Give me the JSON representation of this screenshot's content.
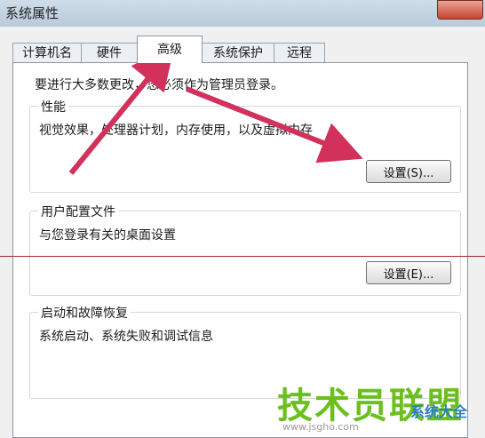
{
  "window": {
    "title": "系统属性"
  },
  "tabs": [
    {
      "label": "计算机名"
    },
    {
      "label": "硬件"
    },
    {
      "label": "高级"
    },
    {
      "label": "系统保护"
    },
    {
      "label": "远程"
    }
  ],
  "active_tab": "高级",
  "notice": "要进行大多数更改，您必须作为管理员登录。",
  "groups": {
    "performance": {
      "title": "性能",
      "desc": "视觉效果，处理器计划，内存使用，以及虚拟内存",
      "button": "设置(S)..."
    },
    "user_profiles": {
      "title": "用户配置文件",
      "desc": "与您登录有关的桌面设置",
      "button": "设置(E)..."
    },
    "startup_recovery": {
      "title": "启动和故障恢复",
      "desc": "系统启动、系统失败和调试信息"
    }
  },
  "watermark": {
    "brand": "技术员联盟",
    "url": "www.jsgho.com",
    "side": "系统大全"
  },
  "colors": {
    "arrow": "#d1315a",
    "divider": "#a52a2a",
    "watermark": "#6bbf1f"
  }
}
